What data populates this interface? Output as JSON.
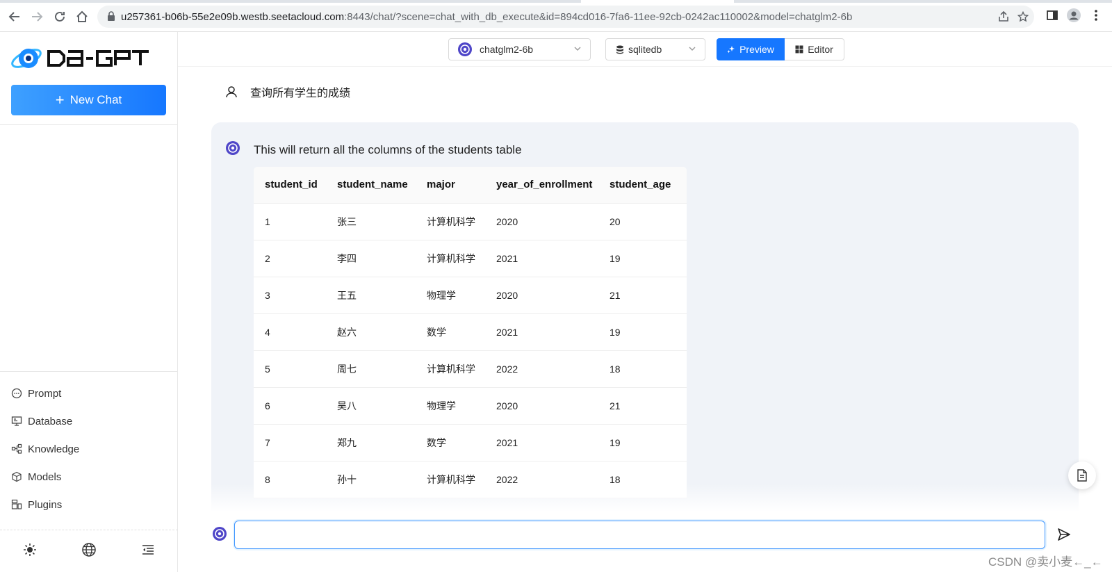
{
  "browser": {
    "url_host": "u257361-b06b-55e2e09b.westb.seetacloud.com",
    "url_rest": ":8443/chat/?scene=chat_with_db_execute&id=894cd016-7fa6-11ee-92cb-0242ac110002&model=chatglm2-6b"
  },
  "sidebar": {
    "new_chat_label": "New Chat",
    "items": [
      {
        "label": "Prompt",
        "icon": "chat-bubble-icon"
      },
      {
        "label": "Database",
        "icon": "monitor-icon"
      },
      {
        "label": "Knowledge",
        "icon": "sitemap-icon"
      },
      {
        "label": "Models",
        "icon": "cube-icon"
      },
      {
        "label": "Plugins",
        "icon": "plugin-icon"
      }
    ],
    "bottom_icons": [
      "sun-icon",
      "globe-icon",
      "menu-fold-icon"
    ]
  },
  "header": {
    "model_select": "chatglm2-6b",
    "db_select": "sqlitedb",
    "preview_label": "Preview",
    "editor_label": "Editor"
  },
  "chat": {
    "user_message": "查询所有学生的成绩",
    "answer_text": "This will return all the columns of the students table",
    "table": {
      "columns": [
        "student_id",
        "student_name",
        "major",
        "year_of_enrollment",
        "student_age"
      ],
      "rows": [
        [
          "1",
          "张三",
          "计算机科学",
          "2020",
          "20"
        ],
        [
          "2",
          "李四",
          "计算机科学",
          "2021",
          "19"
        ],
        [
          "3",
          "王五",
          "物理学",
          "2020",
          "21"
        ],
        [
          "4",
          "赵六",
          "数学",
          "2021",
          "19"
        ],
        [
          "5",
          "周七",
          "计算机科学",
          "2022",
          "18"
        ],
        [
          "6",
          "吴八",
          "物理学",
          "2020",
          "21"
        ],
        [
          "7",
          "郑九",
          "数学",
          "2021",
          "19"
        ],
        [
          "8",
          "孙十",
          "计算机科学",
          "2022",
          "18"
        ]
      ]
    },
    "input_value": ""
  },
  "watermark": "CSDN @卖小麦←_←",
  "colors": {
    "accent": "#1677ff",
    "answer_bg": "#f0f3f8",
    "logo_blue": "#1a8cff"
  }
}
